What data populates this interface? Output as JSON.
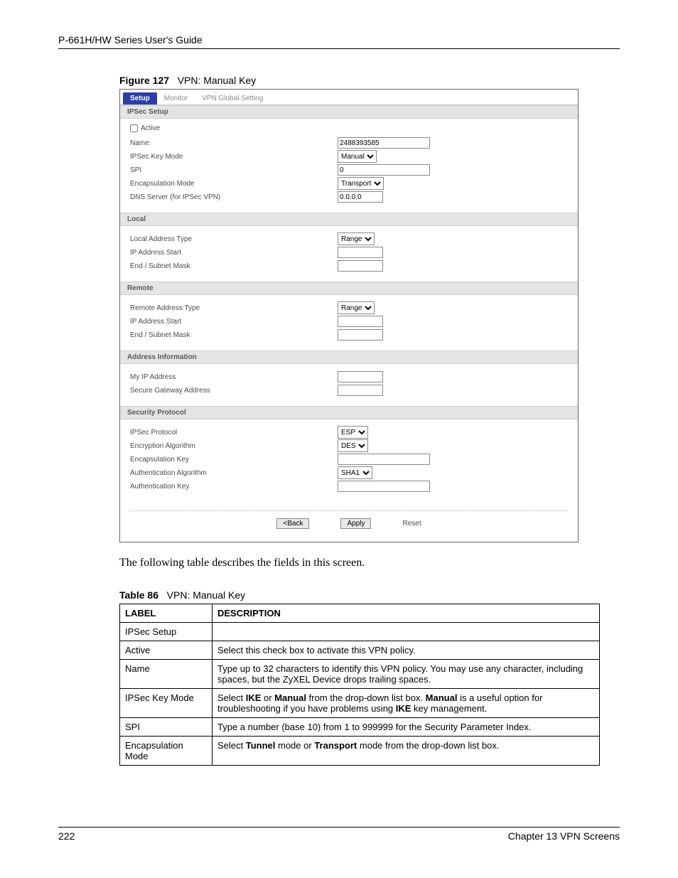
{
  "header": {
    "title": "P-661H/HW Series User's Guide"
  },
  "figure": {
    "label": "Figure 127",
    "title": "VPN: Manual Key"
  },
  "ui": {
    "tabs": {
      "setup": "Setup",
      "monitor": "Monitor",
      "global": "VPN Global Setting"
    },
    "sections": {
      "ipsec_setup": "IPSec Setup",
      "local": "Local",
      "remote": "Remote",
      "address_info": "Address Information",
      "security_protocol": "Security Protocol"
    },
    "labels": {
      "active": "Active",
      "name": "Name:",
      "ipsec_key_mode": "IPSec Key Mode",
      "spi": "SPI",
      "encapsulation_mode": "Encapsulation Mode",
      "dns_server": "DNS Server (for IPSec VPN)",
      "local_address_type": "Local Address Type",
      "ip_address_start": "IP Address Start",
      "end_subnet_mask": "End / Subnet Mask",
      "remote_address_type": "Remote Address Type",
      "my_ip_address": "My IP Address",
      "secure_gateway_address": "Secure Gateway Address",
      "ipsec_protocol": "IPSec Protocol",
      "encryption_algorithm": "Encryption Algorithm",
      "encapsulation_key": "Encapsulation Key",
      "authentication_algorithm": "Authentication Algorithm",
      "authentication_key": "Authentication Key"
    },
    "values": {
      "name": "2488393585",
      "ipsec_key_mode": "Manual",
      "spi": "0",
      "encapsulation_mode": "Transport",
      "dns_server": "0.0.0.0",
      "local_address_type": "Range",
      "remote_address_type": "Range",
      "ipsec_protocol": "ESP",
      "encryption_algorithm": "DES",
      "authentication_algorithm": "SHA1"
    },
    "buttons": {
      "back": "<Back",
      "apply": "Apply",
      "reset": "Reset"
    }
  },
  "body_text": "The following table describes the fields in this screen.",
  "table": {
    "label": "Table 86",
    "title": "VPN: Manual Key",
    "headers": {
      "label": "LABEL",
      "description": "DESCRIPTION"
    },
    "rows": [
      {
        "label": "IPSec Setup",
        "desc": ""
      },
      {
        "label": "Active",
        "desc": "Select this check box to activate this VPN policy."
      },
      {
        "label": "Name",
        "desc": "Type up to 32 characters to identify this VPN policy. You may use any character, including spaces, but the ZyXEL Device drops trailing spaces."
      },
      {
        "label": "IPSec Key Mode",
        "desc_html": "Select <b>IKE</b> or <b>Manual</b> from the drop-down list box. <b>Manual</b> is a useful option for troubleshooting if you have problems using <b>IKE</b> key management."
      },
      {
        "label": "SPI",
        "desc": "Type a number (base 10) from 1 to 999999 for the Security Parameter Index."
      },
      {
        "label": "Encapsulation Mode",
        "desc_html": "Select <b>Tunnel</b> mode or <b>Transport</b> mode from the drop-down list box."
      }
    ]
  },
  "footer": {
    "page": "222",
    "chapter": "Chapter 13 VPN Screens"
  }
}
